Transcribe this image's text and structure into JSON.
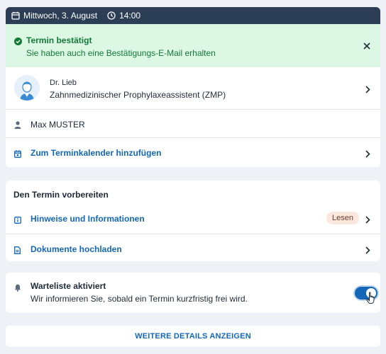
{
  "appointment": {
    "date": "Mittwoch, 3. August",
    "time": "14:00",
    "confirmation": {
      "title": "Termin bestätigt",
      "text": "Sie haben auch eine Bestätigungs-E-Mail erhalten"
    },
    "doctor": {
      "name": "Dr. Lieb",
      "role": "Zahnmedizinischer Prophylaxeassistent (ZMP)"
    },
    "patient": "Max MUSTER",
    "calendar_label": "Zum Terminkalender hinzufügen"
  },
  "prepare": {
    "title": "Den Termin vorbereiten",
    "items": [
      {
        "label": "Hinweise und Informationen",
        "badge": "Lesen"
      },
      {
        "label": "Dokumente hochladen"
      }
    ]
  },
  "waitlist": {
    "title": "Warteliste aktiviert",
    "text": "Wir informieren Sie, sobald ein Termin kurzfristig frei wird.",
    "enabled": true
  },
  "details_button": "WEITERE DETAILS ANZEIGEN",
  "colors": {
    "header_bg": "#2b3e55",
    "accent": "#1467b7",
    "success_bg": "#dcf7e4",
    "success_text": "#127a36",
    "badge_bg": "#fbe7de"
  }
}
